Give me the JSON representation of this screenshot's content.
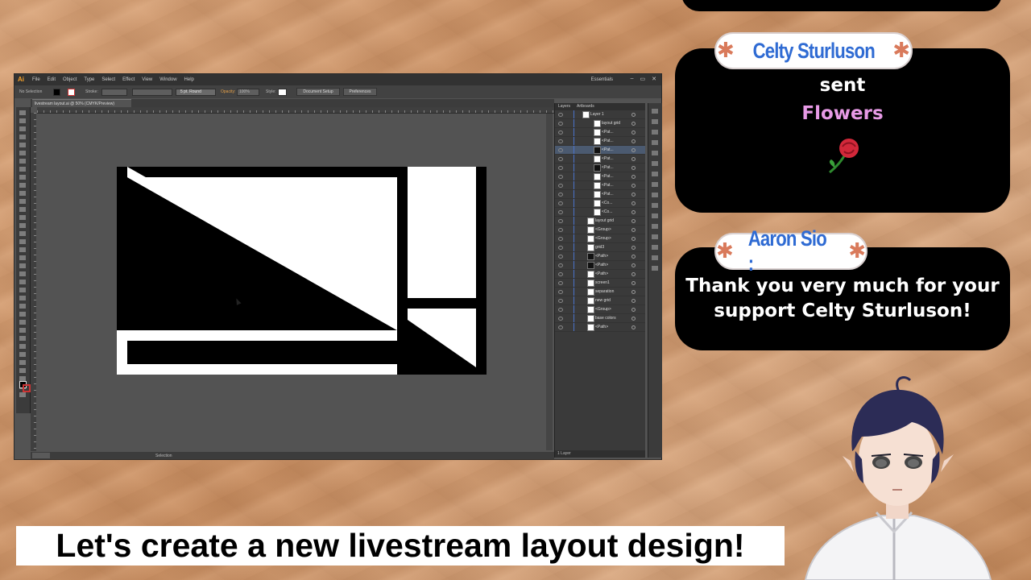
{
  "illustrator": {
    "app_logo": "Ai",
    "menus": [
      "File",
      "Edit",
      "Object",
      "Type",
      "Select",
      "Effect",
      "View",
      "Window",
      "Help"
    ],
    "workspace": "Essentials",
    "window_controls": [
      "–",
      "▭",
      "✕"
    ],
    "control_bar": {
      "selection_status": "No Selection",
      "stroke_label": "Stroke:",
      "brush": "5 pt. Round",
      "opacity_label": "Opacity:",
      "opacity_value": "100%",
      "style_label": "Style:",
      "document_setup": "Document Setup",
      "preferences": "Preferences"
    },
    "document_tab": "livestream layout.ai @ 50% (CMYK/Preview)",
    "panel_tabs": [
      "Layers",
      "Artboards"
    ],
    "layers": [
      {
        "name": "Layer 1",
        "thumb": "mixed",
        "selected": false
      },
      {
        "name": "layout grid",
        "thumb": "mixed",
        "selected": false
      },
      {
        "name": "<Pat...",
        "thumb": "light",
        "selected": false
      },
      {
        "name": "<Pat...",
        "thumb": "light",
        "selected": false
      },
      {
        "name": "<Pat...",
        "thumb": "dark",
        "selected": true
      },
      {
        "name": "<Pat...",
        "thumb": "light",
        "selected": false
      },
      {
        "name": "<Pat...",
        "thumb": "dark",
        "selected": false
      },
      {
        "name": "<Pat...",
        "thumb": "light",
        "selected": false
      },
      {
        "name": "<Pat...",
        "thumb": "light",
        "selected": false
      },
      {
        "name": "<Pat...",
        "thumb": "light",
        "selected": false
      },
      {
        "name": "<Co...",
        "thumb": "light",
        "selected": false
      },
      {
        "name": "<Co...",
        "thumb": "light",
        "selected": false
      },
      {
        "name": "layout grid",
        "thumb": "mixed",
        "selected": false
      },
      {
        "name": "<Group>",
        "thumb": "mixed",
        "selected": false
      },
      {
        "name": "<Group>",
        "thumb": "mixed",
        "selected": false
      },
      {
        "name": "grid3",
        "thumb": "mixed",
        "selected": false
      },
      {
        "name": "<Path>",
        "thumb": "dark",
        "selected": false
      },
      {
        "name": "<Path>",
        "thumb": "dark",
        "selected": false
      },
      {
        "name": "<Path>",
        "thumb": "mixed",
        "selected": false
      },
      {
        "name": "screen1",
        "thumb": "light",
        "selected": false
      },
      {
        "name": "separation",
        "thumb": "light",
        "selected": false
      },
      {
        "name": "new grid",
        "thumb": "mixed",
        "selected": false
      },
      {
        "name": "<Group>",
        "thumb": "mixed",
        "selected": false
      },
      {
        "name": "base colors",
        "thumb": "mixed",
        "selected": false
      },
      {
        "name": "<Path>",
        "thumb": "mixed",
        "selected": false
      }
    ],
    "panel_footer": "1 Layer",
    "status_tool": "Selection"
  },
  "alerts": [
    {
      "username": "Celty Sturluson",
      "line1": "sent",
      "line2": "Flowers",
      "line2_color": "#e79ae6"
    },
    {
      "username": "Aaron Sio :",
      "message_line1": "Thank you very much for your",
      "message_line2": "support Celty Sturluson!"
    }
  ],
  "caption": "Let's create a new livestream layout design!",
  "colors": {
    "username": "#2f6bd3",
    "star": "#d97a5b",
    "illustrator_canvas": "#535353"
  }
}
